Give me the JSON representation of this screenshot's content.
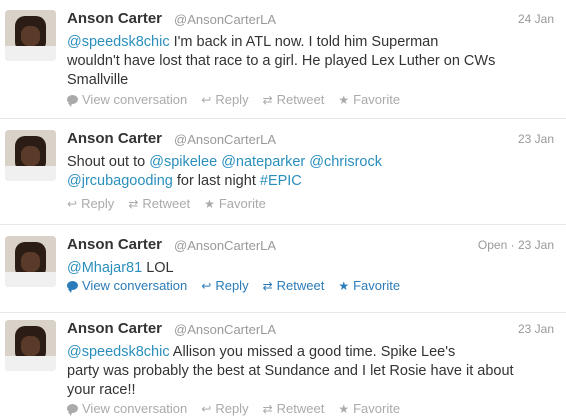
{
  "tweets": [
    {
      "name": "Anson Carter",
      "handle": "@AnsonCarterLA",
      "time": "24 Jan",
      "text_mention": "@speedsk8chic",
      "text_line1": " I'm back in ATL now. I told him Superman",
      "text_line2": "wouldn't have lost that race to a girl. He played Lex Luther on CWs",
      "text_line3": "Smallville",
      "actions": {
        "view": "View conversation",
        "reply": "Reply",
        "retweet": "Retweet",
        "favorite": "Favorite"
      }
    },
    {
      "name": "Anson Carter",
      "handle": "@AnsonCarterLA",
      "time": "23 Jan",
      "text_prefix": "Shout out to ",
      "mention1": "@spikelee",
      "mention2": "@nateparker",
      "mention3": "@chrisrock",
      "mention4": "@jrcubagooding",
      "text_mid": " for last night ",
      "hashtag": "#EPIC",
      "actions": {
        "reply": "Reply",
        "retweet": "Retweet",
        "favorite": "Favorite"
      }
    },
    {
      "name": "Anson Carter",
      "handle": "@AnsonCarterLA",
      "open": "Open",
      "time": "23 Jan",
      "mention": "@Mhajar81",
      "text": " LOL",
      "actions": {
        "view": "View conversation",
        "reply": "Reply",
        "retweet": "Retweet",
        "favorite": "Favorite"
      }
    },
    {
      "name": "Anson Carter",
      "handle": "@AnsonCarterLA",
      "time": "23 Jan",
      "mention": "@speedsk8chic",
      "text_line1": " Allison you missed a good time. Spike Lee's",
      "text_line2": "party was probably the best at Sundance and I let Rosie have it about",
      "text_line3": "your race!!",
      "actions": {
        "view": "View conversation",
        "reply": "Reply",
        "retweet": "Retweet",
        "favorite": "Favorite"
      }
    }
  ],
  "colors": {
    "link": "#2a8fbd",
    "action_inactive": "#aaaaaa",
    "action_active": "#2b7bb9"
  },
  "icons": [
    "avatar",
    "bubble-icon",
    "reply-icon",
    "retweet-icon",
    "star-icon"
  ]
}
